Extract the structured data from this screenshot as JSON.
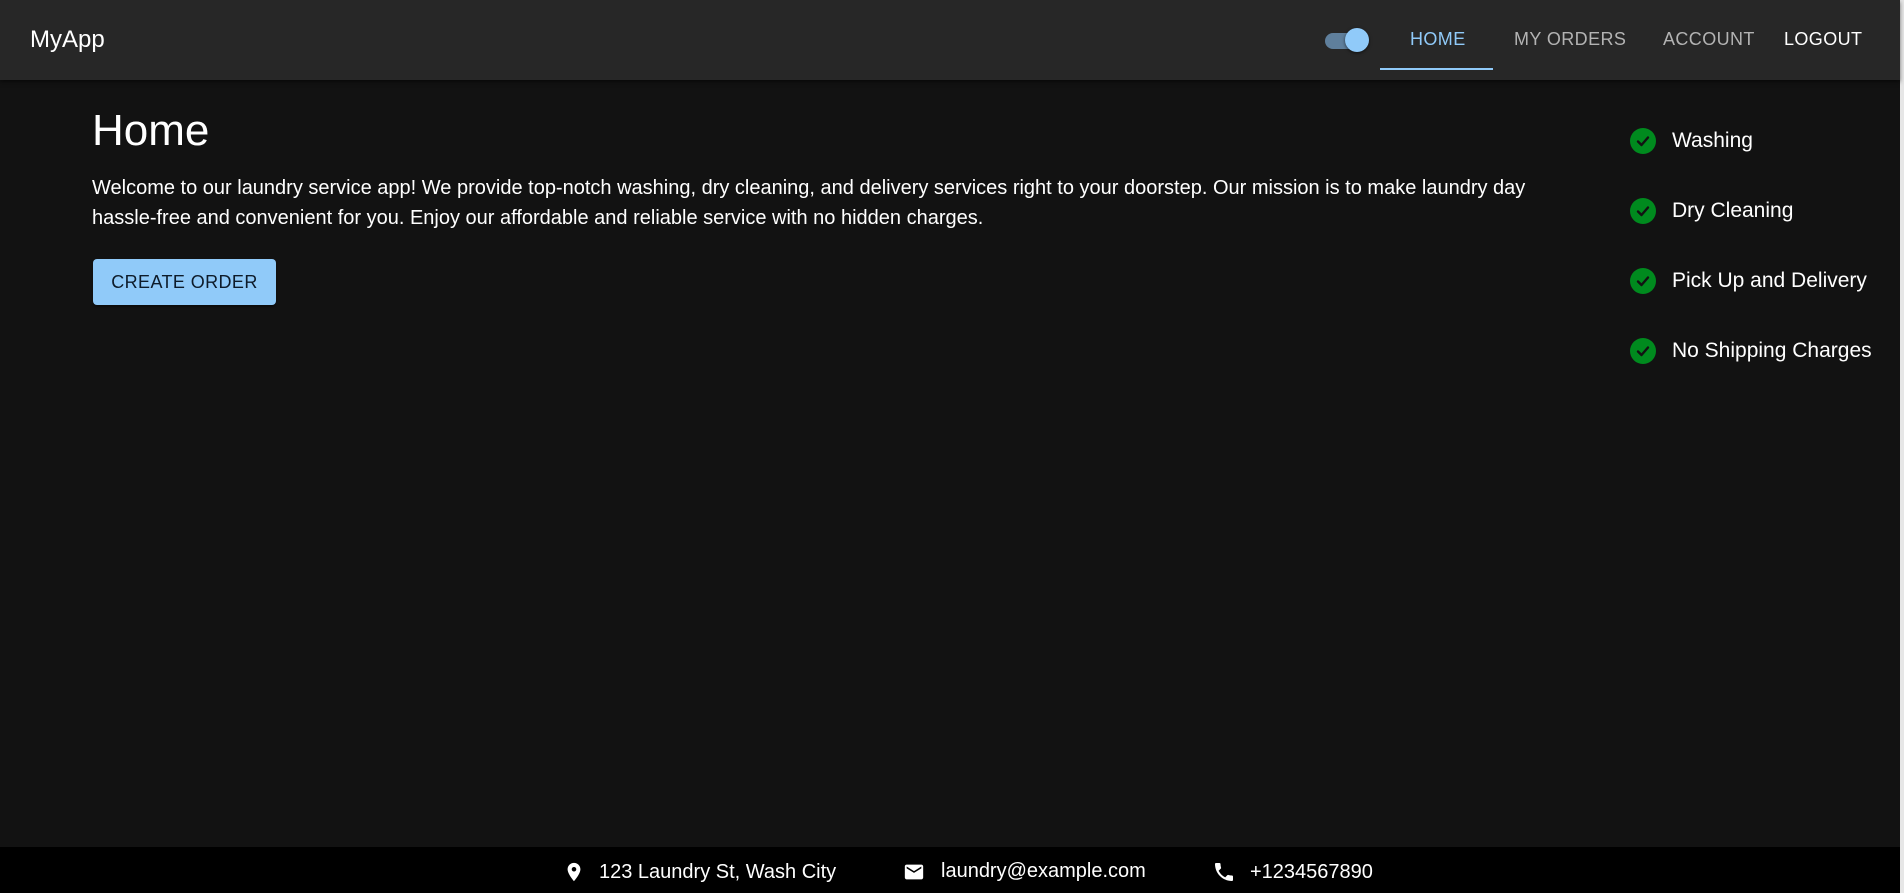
{
  "app": {
    "title": "MyApp"
  },
  "nav": {
    "theme_toggle": {
      "state": "on"
    },
    "tabs": [
      {
        "label": "HOME",
        "active": true
      },
      {
        "label": "MY ORDERS",
        "active": false
      },
      {
        "label": "ACCOUNT",
        "active": false
      }
    ],
    "logout_label": "LOGOUT"
  },
  "main": {
    "title": "Home",
    "intro": "Welcome to our laundry service app! We provide top-notch washing, dry cleaning, and delivery services right to your doorstep. Our mission is to make laundry day hassle-free and convenient for you. Enjoy our affordable and reliable service with no hidden charges.",
    "create_order_label": "CREATE ORDER"
  },
  "features": [
    {
      "label": "Washing",
      "icon": "check-circle-icon"
    },
    {
      "label": "Dry Cleaning",
      "icon": "check-circle-icon"
    },
    {
      "label": "Pick Up and Delivery",
      "icon": "check-circle-icon"
    },
    {
      "label": "No Shipping Charges",
      "icon": "check-circle-icon"
    }
  ],
  "footer": {
    "address": {
      "text": "123 Laundry St, Wash City",
      "icon": "location-pin-icon"
    },
    "email": {
      "text": "laundry@example.com",
      "icon": "mail-icon"
    },
    "phone": {
      "text": "+1234567890",
      "icon": "phone-icon"
    }
  },
  "colors": {
    "background": "#121212",
    "appbar": "#272727",
    "accent": "#90caf9",
    "check": "#008a1e",
    "footer": "#000000"
  }
}
